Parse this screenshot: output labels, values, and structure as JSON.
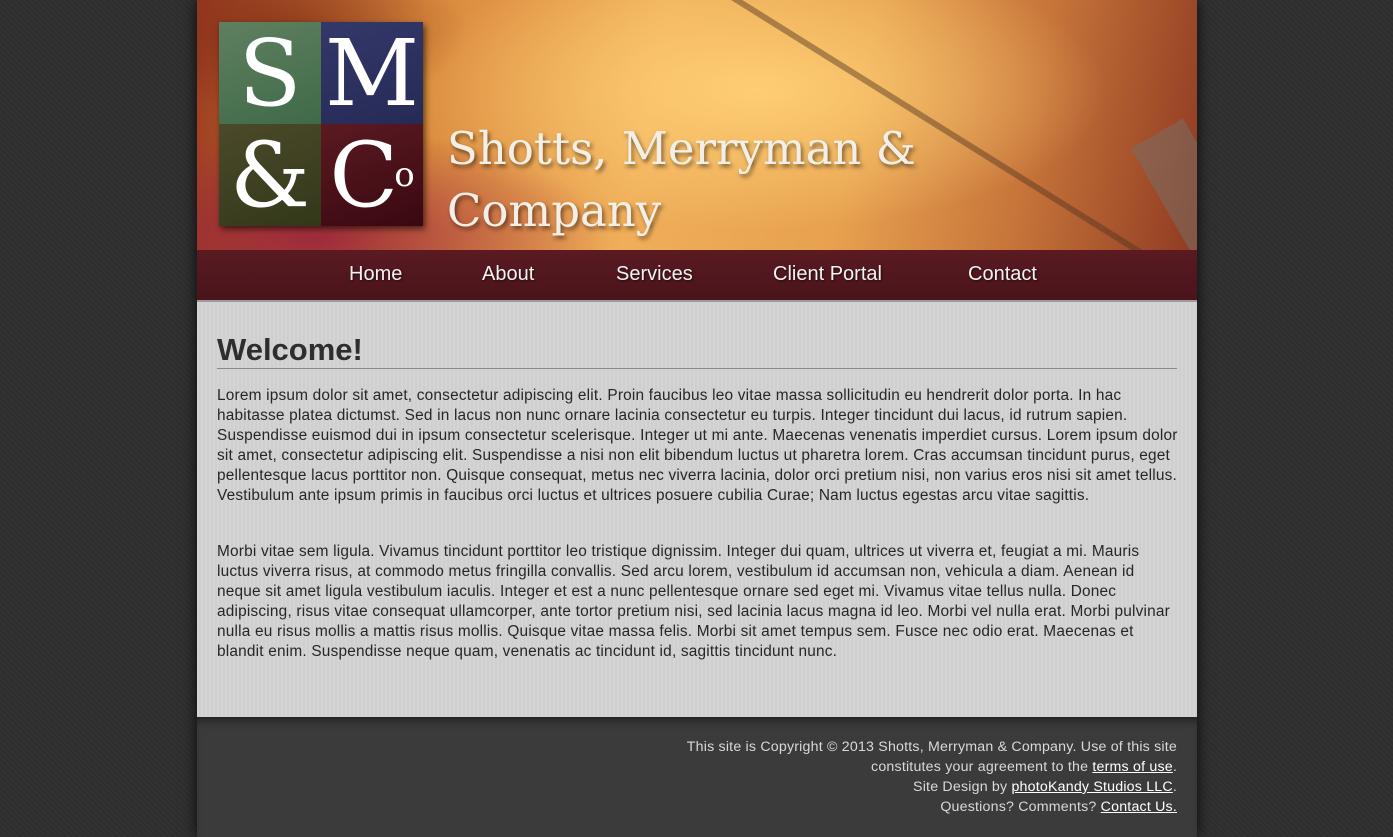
{
  "header": {
    "logo": {
      "letters": [
        "S",
        "M",
        "&",
        "C"
      ],
      "superscript": "o"
    },
    "title_line1": "Shotts, Merryman &",
    "title_line2": "Company"
  },
  "nav": {
    "items": [
      {
        "label": "Home"
      },
      {
        "label": "About"
      },
      {
        "label": "Services"
      },
      {
        "label": "Client Portal"
      },
      {
        "label": "Contact"
      }
    ]
  },
  "main": {
    "heading": "Welcome!",
    "paragraphs": [
      "Lorem ipsum dolor sit amet, consectetur adipiscing elit. Proin faucibus leo vitae massa sollicitudin eu hendrerit dolor porta. In hac habitasse platea dictumst. Sed in lacus non nunc ornare lacinia consectetur eu turpis. Integer tincidunt dui lacus, id rutrum sapien. Suspendisse euismod dui in ipsum consectetur scelerisque. Integer ut mi ante. Maecenas venenatis imperdiet cursus. Lorem ipsum dolor sit amet, consectetur adipiscing elit. Suspendisse a nisi non elit bibendum luctus ut pharetra lorem. Cras accumsan tincidunt purus, eget pellentesque lacus porttitor non. Quisque consequat, metus nec viverra lacinia, dolor orci pretium nisi, non varius eros nisi sit amet tellus. Vestibulum ante ipsum primis in faucibus orci luctus et ultrices posuere cubilia Curae; Nam luctus egestas arcu vitae sagittis.",
      "Morbi vitae sem ligula. Vivamus tincidunt porttitor leo tristique dignissim. Integer dui quam, ultrices ut viverra et, feugiat a mi. Mauris luctus viverra risus, at commodo metus fringilla convallis. Sed arcu lorem, vestibulum id accumsan non, vehicula a diam. Aenean id neque sit amet ligula vestibulum iaculis. Integer et est a nunc pellentesque ornare sed eget mi. Vivamus vitae tellus nulla. Donec adipiscing, risus vitae consequat ullamcorper, ante tortor pretium nisi, sed lacinia lacus magna id leo. Morbi vel nulla erat. Morbi pulvinar nulla eu risus mollis a mattis risus mollis. Quisque vitae massa felis. Morbi sit amet tempus sem. Fusce nec odio erat. Maecenas et blandit enim. Suspendisse neque quam, venenatis ac tincidunt id, sagittis tincidunt nunc."
    ]
  },
  "footer": {
    "copyright_line": "This site is Copyright © 2013 Shotts, Merryman & Company. Use of this site constitutes your agreement to the",
    "terms_link": "terms of use",
    "terms_after": ".",
    "design_prefix": "Site Design by",
    "design_link": "photoKandy Studios LLC",
    "design_after": ".",
    "questions_prefix": "Questions? Comments?",
    "contact_link": "Contact Us."
  },
  "colors": {
    "nav_bg": "#4f161d",
    "content_bg": "#d2d2d2",
    "page_bg": "#2f2f2f"
  }
}
